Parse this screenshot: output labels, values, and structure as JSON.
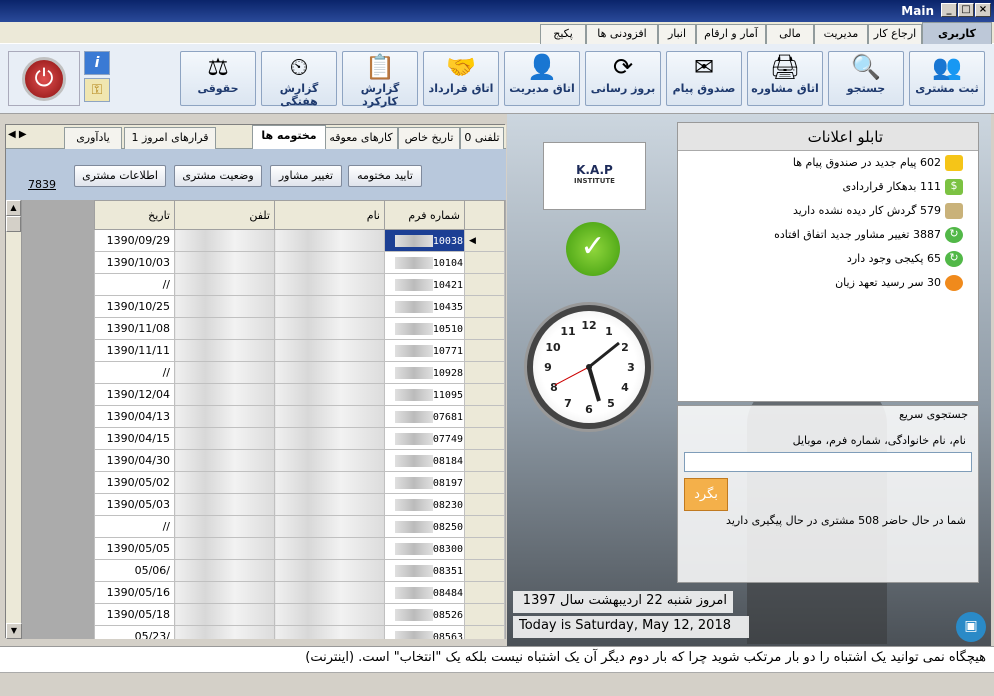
{
  "window": {
    "title": "Main"
  },
  "menu_tabs": [
    "کاربری",
    "ارجاع کار",
    "مدیریت",
    "مالی",
    "آمار و ارقام",
    "انبار",
    "افزودنی ها",
    "پکیج"
  ],
  "toolbar": [
    {
      "label": "ثبت مشتری",
      "icon": "users-icon"
    },
    {
      "label": "جستجو",
      "icon": "magnifier-icon"
    },
    {
      "label": "اتاق مشاوره",
      "icon": "printer-icon"
    },
    {
      "label": "صندوق پیام",
      "icon": "envelope-icon"
    },
    {
      "label": "بروز رسانی",
      "icon": "refresh-icon"
    },
    {
      "label": "اتاق مدیریت",
      "icon": "manager-icon"
    },
    {
      "label": "اتاق قرارداد",
      "icon": "handshake-icon"
    },
    {
      "label": "گزارش کارکرد",
      "icon": "report-icon"
    },
    {
      "label": "گزارش هفتگی",
      "icon": "clock-report-icon"
    },
    {
      "label": "حقوقی",
      "icon": "scales-icon"
    }
  ],
  "left_tabs": [
    "تلفنی 0",
    "تاریخ خاص",
    "کارهای معوقه",
    "مختومه ها",
    "قرارهای امروز 1",
    "یادآوری"
  ],
  "panel_buttons": [
    "تایید مختومه",
    "تغییر مشاور",
    "وضعیت مشتری",
    "اطلاعات مشتری"
  ],
  "record_count": "7839",
  "grid": {
    "headers": [
      "شماره فرم",
      "نام",
      "تلفن",
      "تاریخ"
    ],
    "rows": [
      {
        "form": "10038",
        "date": "1390/09/29"
      },
      {
        "form": "10104",
        "date": "1390/10/03"
      },
      {
        "form": "10421",
        "date": "//"
      },
      {
        "form": "10435",
        "date": "1390/10/25"
      },
      {
        "form": "10510",
        "date": "1390/11/08"
      },
      {
        "form": "10771",
        "date": "1390/11/11"
      },
      {
        "form": "10928",
        "date": "//"
      },
      {
        "form": "11095",
        "date": "1390/12/04"
      },
      {
        "form": "07681",
        "date": "1390/04/13"
      },
      {
        "form": "07749",
        "date": "1390/04/15"
      },
      {
        "form": "08184",
        "date": "1390/04/30"
      },
      {
        "form": "08197",
        "date": "1390/05/02"
      },
      {
        "form": "08230",
        "date": "1390/05/03"
      },
      {
        "form": "08250",
        "date": "//"
      },
      {
        "form": "08300",
        "date": "1390/05/05"
      },
      {
        "form": "08351",
        "date": "05/06/"
      },
      {
        "form": "08484",
        "date": "1390/05/16"
      },
      {
        "form": "08526",
        "date": "1390/05/18"
      },
      {
        "form": "08563",
        "date": "05/23/"
      }
    ]
  },
  "logo": {
    "text": "K.A.P",
    "sub": "INSTITUTE"
  },
  "board": {
    "title": "تابلو اعلانات",
    "items": [
      {
        "text": "602 پیام جدید در صندوق پیام ها",
        "icon": "envelope-icon",
        "color": "#f5c518"
      },
      {
        "text": "111 بدهکار  قراردادی",
        "icon": "dollar-icon",
        "color": "#7cc242"
      },
      {
        "text": "579 گردش کار دیده نشده دارید",
        "icon": "document-icon",
        "color": "#c9b27a"
      },
      {
        "text": "3887 تغییر مشاور جدید اتفاق افتاده",
        "icon": "recycle-icon",
        "color": "#52b848"
      },
      {
        "text": "65 پکیجی وجود دارد",
        "icon": "recycle-icon",
        "color": "#52b848"
      },
      {
        "text": "30 سر رسید تعهد زیان",
        "icon": "clock-icon",
        "color": "#f08a1c"
      }
    ]
  },
  "search": {
    "title": "جستجوی سریع",
    "hint": "نام، نام خانوادگی، شماره فرم، موبایل",
    "button": "بگرد",
    "note": "شما در حال حاضر 508 مشتری در حال پیگیری دارید"
  },
  "date_fa": "امروز شنبه 22 اردیبهشت سال 1397",
  "date_en": "Today is  Saturday, May 12, 2018",
  "bottom_note": "هیچگاه نمی توانید یک اشتباه را دو بار مرتکب شوید چرا که بار دوم دیگر آن یک اشتباه نیست بلکه یک \"انتخاب\" است.   (اینترنت)"
}
